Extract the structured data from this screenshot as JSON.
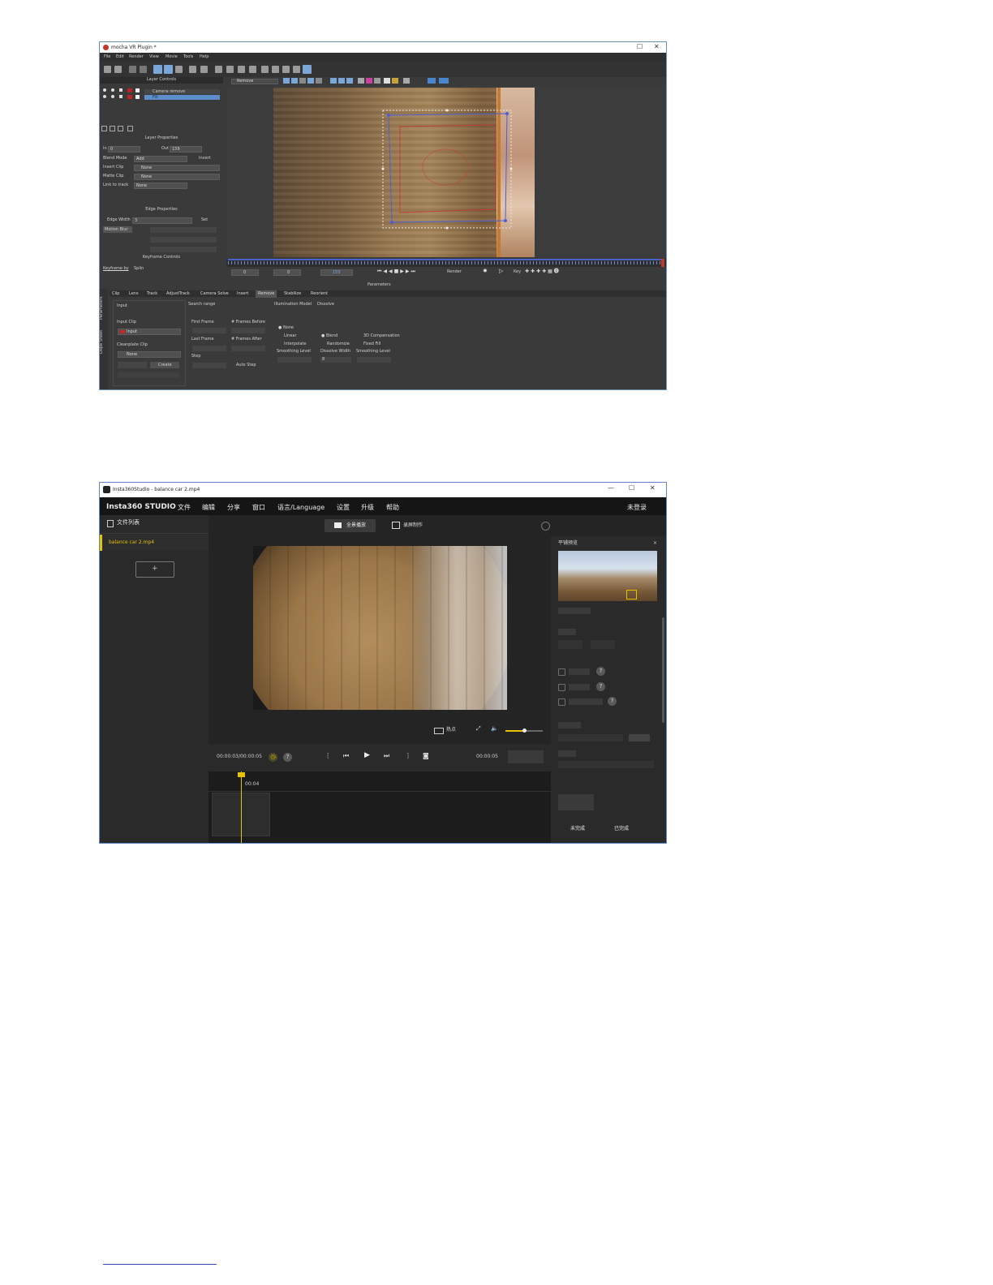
{
  "mocha": {
    "window_title": "mocha VR Plugin *",
    "menu": [
      "File",
      "Edit",
      "Render",
      "View",
      "Movie",
      "Tools",
      "Help"
    ],
    "layer_controls": {
      "header": "Layer Controls",
      "layers": [
        "Camera remove",
        "Fill"
      ]
    },
    "layer_properties": {
      "header": "Layer Properties",
      "in_label": "In",
      "in_value": "0",
      "out_label": "Out",
      "out_value": "159",
      "blend_mode_label": "Blend Mode",
      "blend_mode_value": "Add",
      "invert_label": "Invert",
      "insert_clip_label": "Insert Clip",
      "insert_clip_value": "None",
      "matte_clip_label": "Matte Clip",
      "matte_clip_value": "None",
      "link_to_track_label": "Link to track",
      "link_to_track_value": "None"
    },
    "edge_properties": {
      "header": "Edge Properties",
      "edge_width_label": "Edge Width",
      "edge_width_value": "3",
      "set_label": "Set",
      "motion_blur_label": "Motion Blur"
    },
    "keyframe_controls": {
      "header": "Keyframe Controls",
      "keyframe_by_label": "Keyframe by",
      "keyframe_by_value": "Splin"
    },
    "viewer_toolbar": {
      "remove_dropdown": "Remove"
    },
    "timeline": {
      "start_frame": "0",
      "current_frame": "0",
      "end_frame": "159",
      "render_label": "Render",
      "key_label": "Key"
    },
    "parameters": {
      "header": "Parameters",
      "side_tabs": [
        "Parameters",
        "Dope Sheet"
      ],
      "tabs": [
        "Clip",
        "Lens",
        "Track",
        "AdjustTrack",
        "Camera Solve",
        "Insert",
        "Remove",
        "Stabilize",
        "Reorient"
      ],
      "active_tab": "Remove",
      "input_label": "Input",
      "input_clip_label": "Input Clip",
      "input_clip_value": "Input",
      "cleanplate_clip_label": "Cleanplate Clip",
      "cleanplate_clip_value": "None",
      "create_label": "Create",
      "search_range_label": "Search range",
      "first_frame_label": "First Frame",
      "frames_before_label": "# Frames Before",
      "last_frame_label": "Last Frame",
      "frames_after_label": "# Frames After",
      "step_label": "Step",
      "auto_step_label": "Auto Step",
      "illumination_model_label": "Illumination Model",
      "illumination_options": [
        "None",
        "Linear",
        "Interpolate"
      ],
      "smoothing_level_label": "Smoothing Level",
      "dissolve_label": "Dissolve",
      "dissolve_options": [
        "Blend",
        "Randomize"
      ],
      "dissolve_width_label": "Dissolve Width",
      "dissolve_width_value": "8",
      "extra_options": [
        "3D Compensation",
        "Fixed Fill"
      ],
      "smoothing_level_label_2": "Smoothing Level"
    }
  },
  "insta": {
    "window_title": "Insta360Studio - balance car 2.mp4",
    "window_controls": [
      "—",
      "☐",
      "✕"
    ],
    "brand": "Insta360 STUDIO",
    "menu": [
      "文件",
      "编辑",
      "分享",
      "窗口",
      "语言/Language",
      "设置",
      "升级",
      "帮助"
    ],
    "login": "未登录",
    "file_list_header": "文件列表",
    "file_item": "balance car 2.mp4",
    "add_button": "+",
    "view_modes": [
      "全景播放",
      "录屏制作"
    ],
    "right_panel_title": "平铺预览",
    "bottom_controls_label": "热点",
    "current_time": "00:00:03/00:00:05",
    "end_time": "00:00:05",
    "playhead_label": "00:04",
    "status_tabs": [
      "未完成",
      "已完成"
    ]
  }
}
